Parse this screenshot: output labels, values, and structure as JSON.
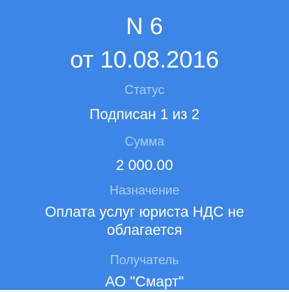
{
  "document": {
    "number": "N 6",
    "date": "от 10.08.2016"
  },
  "fields": {
    "status_label": "Статус",
    "status_value": "Подписан 1 из 2",
    "amount_label": "Сумма",
    "amount_value": "2 000.00",
    "purpose_label": "Назначение",
    "purpose_value": "Оплата услуг юриста НДС не облагается",
    "recipient_label": "Получатель",
    "recipient_value": "АО \"Смарт\""
  },
  "colors": {
    "background": "#3d86e6",
    "label_text": "#a9cdf5",
    "value_text": "#ffffff"
  }
}
